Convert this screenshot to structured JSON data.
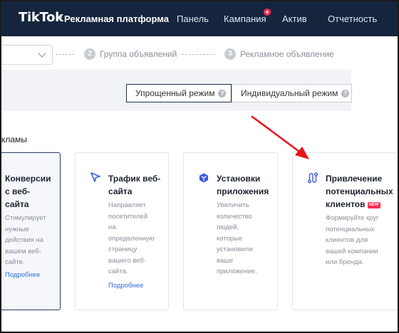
{
  "header": {
    "logo": "TikTok",
    "logo_separator": ":",
    "platform": "Рекламная платформа",
    "nav": [
      "Панель",
      "Кампания",
      "Актив",
      "Отчетность"
    ],
    "nav_badge": "+"
  },
  "steps": {
    "step2_num": "2",
    "step2_label": "Группа объявлений",
    "step3_num": "3",
    "step3_label": "Рекламное объявление"
  },
  "modes": {
    "simple": "Упрощенный режим",
    "custom": "Индивидуальный режим",
    "help_glyph": "?"
  },
  "section_label": "кламы",
  "cards": [
    {
      "title": [
        "Конверсии",
        "с веб-",
        "сайта"
      ],
      "desc": [
        "Стимулирует",
        "нужные",
        "действия на",
        "вашем веб-",
        "сайте."
      ],
      "link": "Подробнее"
    },
    {
      "title": [
        "Трафик веб-",
        "сайта"
      ],
      "desc": [
        "Направляет",
        "посетителей",
        "на",
        "определенную",
        "страницу",
        "вашего веб-",
        "сайта."
      ],
      "link": "Подробнее"
    },
    {
      "title": [
        "Установки",
        "приложения"
      ],
      "desc": [
        "Увеличить",
        "количество",
        "людей,",
        "которые",
        "установили",
        "ваше",
        "приложение."
      ]
    },
    {
      "title": [
        "Привлечение",
        "потенциальных",
        "клиентов"
      ],
      "badge": "NEW",
      "desc": [
        "Формируйте круг",
        "потенциальных",
        "клиентов для",
        "вашей компании",
        "или бренда."
      ]
    }
  ],
  "colors": {
    "nav_bg": "#15253e",
    "accent_link": "#2c6bd6",
    "arrow_red": "#e8141b",
    "badge_red": "#fe2c55"
  }
}
